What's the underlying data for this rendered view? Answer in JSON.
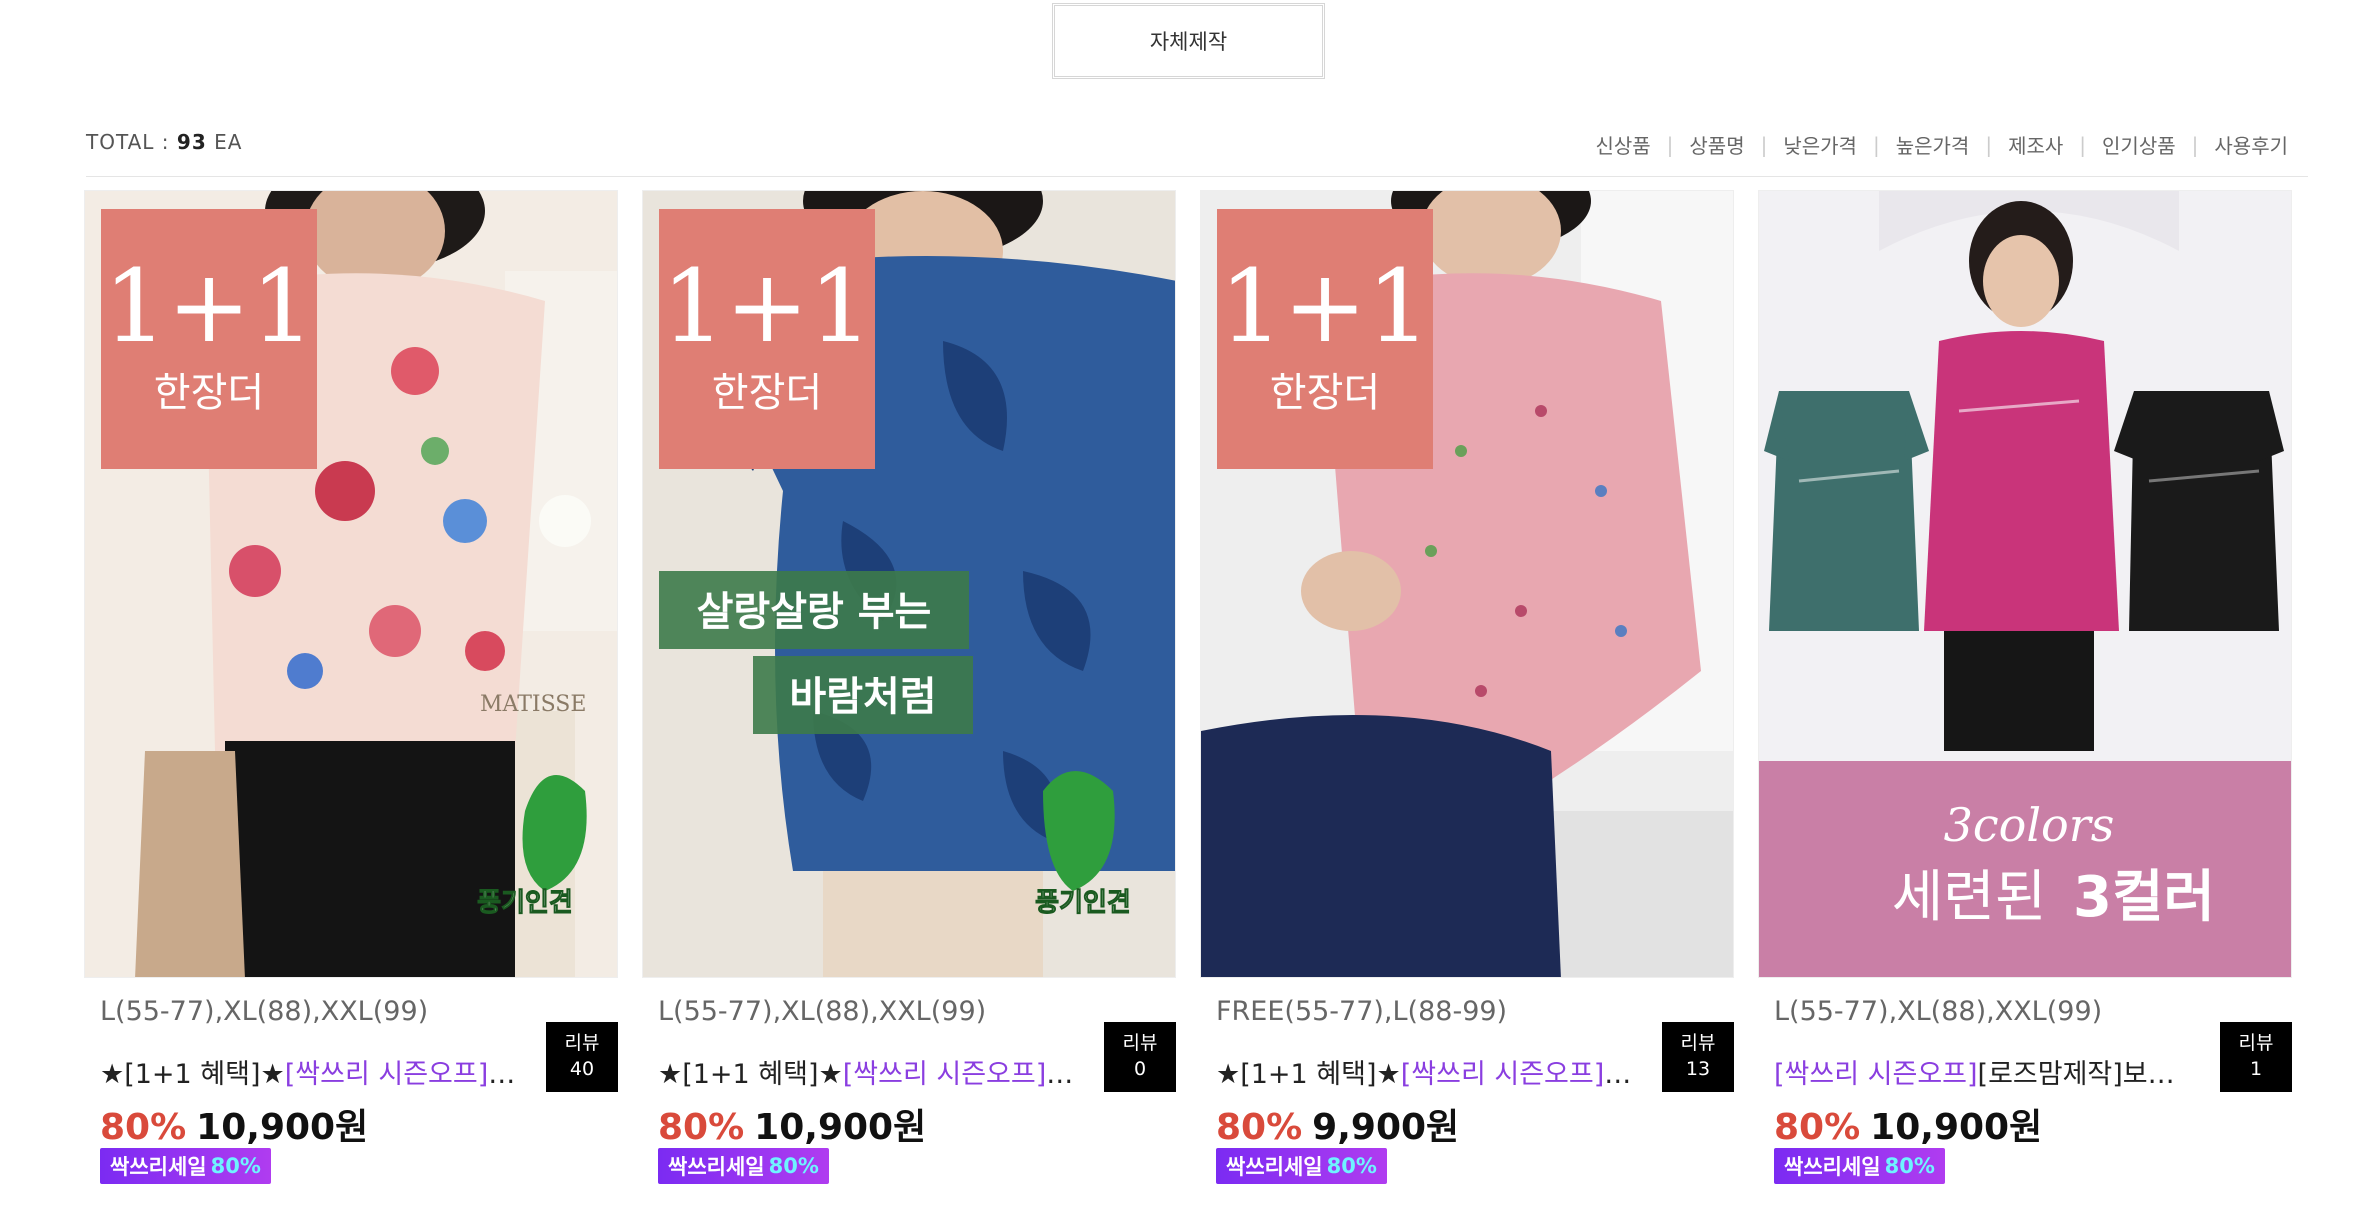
{
  "category_tab": {
    "label": "자체제작"
  },
  "toolbar": {
    "total_prefix": "TOTAL :",
    "total_count": "93",
    "total_unit": "EA",
    "sort_options": [
      "신상품",
      "상품명",
      "낮은가격",
      "높은가격",
      "제조사",
      "인기상품",
      "사용후기"
    ]
  },
  "colors": {
    "discount": "#d94a3b",
    "highlight": "#8a3ee0",
    "promo_badge": "#8e35f0",
    "overlay_badge": "#df7e74"
  },
  "products": [
    {
      "image_overlay": {
        "badge_main": "1+1",
        "badge_sub": "한장더",
        "leaf_label": "풍기인견",
        "sign": "MATISSE"
      },
      "options": "L(55-77),XL(88),XXL(99)",
      "name_prefix": "★[1+1 혜택]★",
      "name_highlight": "[싹쓰리 시즌오프]",
      "name_rest": "[…",
      "review_label": "리뷰",
      "review_count": "40",
      "discount_rate": "80%",
      "price": "10,900원",
      "promo_label": "싹쓰리세일",
      "promo_pct": "80%"
    },
    {
      "image_overlay": {
        "badge_main": "1+1",
        "badge_sub": "한장더",
        "leaf_label": "풍기인견",
        "caption_1": "살랑살랑 부는",
        "caption_2": "바람처럼"
      },
      "options": "L(55-77),XL(88),XXL(99)",
      "name_prefix": "★[1+1 혜택]★",
      "name_highlight": "[싹쓰리 시즌오프]",
      "name_rest": "[…",
      "review_label": "리뷰",
      "review_count": "0",
      "discount_rate": "80%",
      "price": "10,900원",
      "promo_label": "싹쓰리세일",
      "promo_pct": "80%"
    },
    {
      "image_overlay": {
        "badge_main": "1+1",
        "badge_sub": "한장더"
      },
      "options": "FREE(55-77),L(88-99)",
      "name_prefix": "★[1+1 혜택]★",
      "name_highlight": "[싹쓰리 시즌오프]",
      "name_rest": "[…",
      "review_label": "리뷰",
      "review_count": "13",
      "discount_rate": "80%",
      "price": "9,900원",
      "promo_label": "싹쓰리세일",
      "promo_pct": "80%"
    },
    {
      "image_overlay": {
        "script": "3colors",
        "caption_pre": "세련된",
        "caption_bold": "3컬러"
      },
      "options": "L(55-77),XL(88),XXL(99)",
      "name_prefix": "",
      "name_highlight": "[싹쓰리 시즌오프]",
      "name_rest": "[로즈맘제작]보한…",
      "review_label": "리뷰",
      "review_count": "1",
      "discount_rate": "80%",
      "price": "10,900원",
      "promo_label": "싹쓰리세일",
      "promo_pct": "80%"
    }
  ]
}
